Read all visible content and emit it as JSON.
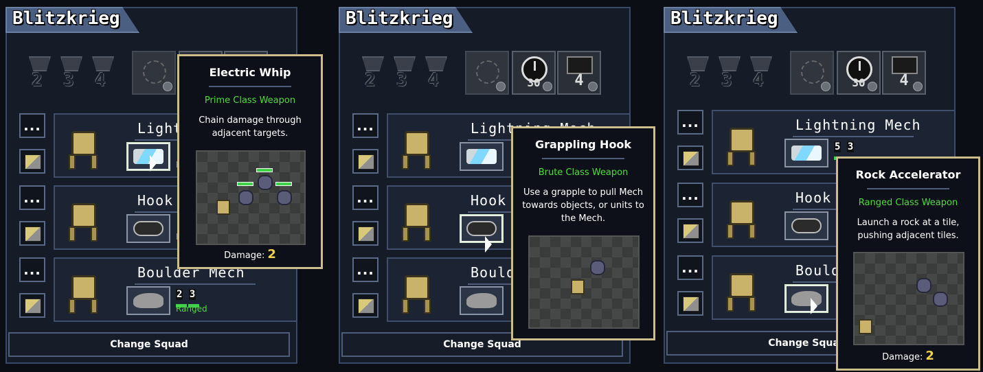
{
  "panels": [
    {
      "title": "Blitzkrieg",
      "trophies": [
        "2",
        "3",
        "4"
      ],
      "rewards": [
        {
          "icon": "gears-icon",
          "value": ""
        },
        {
          "icon": "clock-icon",
          "value": ""
        },
        {
          "icon": "mech-box-icon",
          "value": ""
        }
      ],
      "mechs": [
        {
          "name": "Lightning Mech",
          "weapon_icon": "electric-whip-icon",
          "class": "Prime",
          "power": "",
          "core": ""
        },
        {
          "name": "Hook Mech",
          "weapon_icon": "grappling-hook-icon",
          "class": "Brute",
          "power": "",
          "core": ""
        },
        {
          "name": "Boulder Mech",
          "weapon_icon": "rock-accelerator-icon",
          "class": "Ranged",
          "power": "2",
          "core": "3"
        }
      ],
      "change_label": "Change Squad",
      "tooltip": {
        "title": "Electric Whip",
        "class": "Prime Class Weapon",
        "desc": "Chain damage through adjacent targets.",
        "damage_label": "Damage:",
        "damage": "2"
      }
    },
    {
      "title": "Blitzkrieg",
      "trophies": [
        "2",
        "3",
        "4"
      ],
      "rewards": [
        {
          "icon": "gears-icon",
          "value": ""
        },
        {
          "icon": "clock-icon",
          "value": "30"
        },
        {
          "icon": "mech-box-icon",
          "value": "4"
        }
      ],
      "mechs": [
        {
          "name": "Lightning Mech",
          "weapon_icon": "electric-whip-icon",
          "class": "",
          "power": "",
          "core": ""
        },
        {
          "name": "Hook Mech",
          "weapon_icon": "grappling-hook-icon",
          "class": "",
          "power": "",
          "core": ""
        },
        {
          "name": "Boulder Mech",
          "weapon_icon": "rock-accelerator-icon",
          "class": "",
          "power": "",
          "core": ""
        }
      ],
      "change_label": "Change Squad",
      "tooltip": {
        "title": "Grappling Hook",
        "class": "Brute Class Weapon",
        "desc": "Use a grapple to pull Mech towards objects, or units to the Mech.",
        "damage_label": "",
        "damage": ""
      }
    },
    {
      "title": "Blitzkrieg",
      "trophies": [
        "2",
        "3",
        "4"
      ],
      "rewards": [
        {
          "icon": "gears-icon",
          "value": ""
        },
        {
          "icon": "clock-icon",
          "value": "30"
        },
        {
          "icon": "mech-box-icon",
          "value": "4"
        }
      ],
      "mechs": [
        {
          "name": "Lightning Mech",
          "weapon_icon": "electric-whip-icon",
          "class": "",
          "power": "5",
          "core": "3"
        },
        {
          "name": "Hook Mech",
          "weapon_icon": "grappling-hook-icon",
          "class": "",
          "power": "",
          "core": ""
        },
        {
          "name": "Boulder Mech",
          "weapon_icon": "rock-accelerator-icon",
          "class": "",
          "power": "",
          "core": ""
        }
      ],
      "change_label": "Change Squad",
      "tooltip": {
        "title": "Rock Accelerator",
        "class": "Ranged Class Weapon",
        "desc": "Launch a rock at a tile, pushing adjacent tiles.",
        "damage_label": "Damage:",
        "damage": "2"
      }
    }
  ]
}
